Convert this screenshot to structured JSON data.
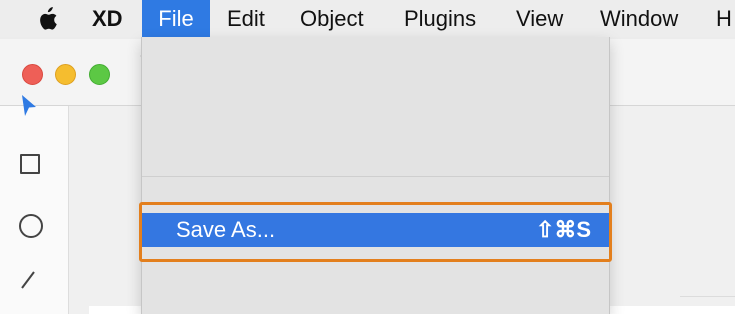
{
  "menubar": {
    "apple_icon": "apple-logo-icon",
    "items": [
      {
        "label": "XD",
        "bold": true
      },
      {
        "label": "File",
        "active": true
      },
      {
        "label": "Edit"
      },
      {
        "label": "Object"
      },
      {
        "label": "Plugins"
      },
      {
        "label": "View"
      },
      {
        "label": "Window"
      },
      {
        "label": "H"
      }
    ]
  },
  "window": {
    "traffic_lights": [
      "close",
      "minimize",
      "zoom"
    ],
    "toolbar_fragment": "‹",
    "tools": [
      "select-arrow-icon",
      "rectangle-icon",
      "ellipse-icon",
      "line-icon"
    ]
  },
  "file_menu": {
    "highlighted_item": {
      "label": "Save As...",
      "shortcut": "⇧⌘S"
    }
  },
  "colors": {
    "menu_active": "#2f7ae3",
    "item_highlight": "#3477e1",
    "callout_border": "#e37f1d",
    "select_tool": "#2f7ae3"
  }
}
